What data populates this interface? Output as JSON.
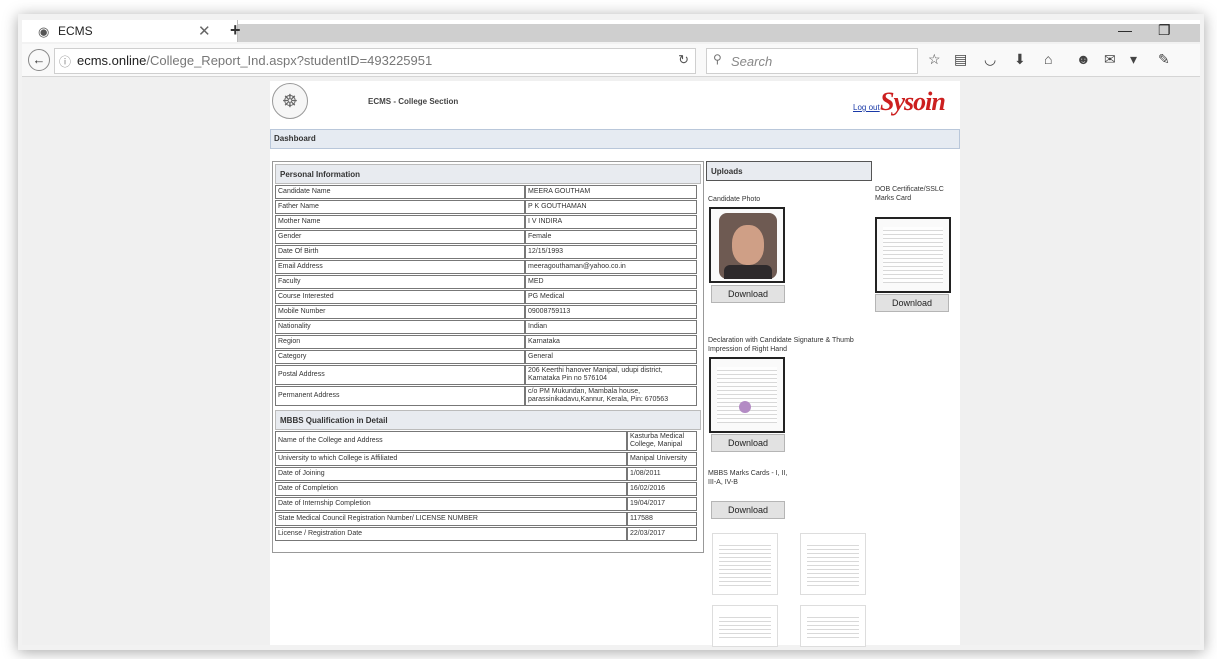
{
  "browser": {
    "tab_title": "ECMS",
    "url_domain": "ecms.online",
    "url_path": "/College_Report_Ind.aspx?studentID=493225951",
    "search_placeholder": "Search"
  },
  "header": {
    "section_title": "ECMS - College Section",
    "logout_label": "Log out",
    "brand_name": "Sysoin"
  },
  "dashboard_label": "Dashboard",
  "personal": {
    "heading": "Personal Information",
    "rows": [
      {
        "label": "Candidate Name",
        "value": "MEERA GOUTHAM"
      },
      {
        "label": "Father Name",
        "value": "P K GOUTHAMAN"
      },
      {
        "label": "Mother Name",
        "value": "I V INDIRA"
      },
      {
        "label": "Gender",
        "value": "Female"
      },
      {
        "label": "Date Of Birth",
        "value": "12/15/1993"
      },
      {
        "label": "Email Address",
        "value": "meeragouthaman@yahoo.co.in"
      },
      {
        "label": "Faculty",
        "value": "MED"
      },
      {
        "label": "Course Interested",
        "value": "PG Medical"
      },
      {
        "label": "Mobile Number",
        "value": "09008759113"
      },
      {
        "label": "Nationality",
        "value": "Indian"
      },
      {
        "label": "Region",
        "value": "Karnataka"
      },
      {
        "label": "Category",
        "value": "General"
      },
      {
        "label": "Postal Address",
        "value": "206 Keerthi hanover Manipal, udupi district, Karnataka Pin no 576104"
      },
      {
        "label": "Permanent Address",
        "value": "c/o PM Mukundan, Mambala house, parassinikadavu,Kannur, Kerala, Pin: 670563"
      }
    ]
  },
  "mbbs": {
    "heading": "MBBS Qualification in Detail",
    "rows": [
      {
        "label": "Name of the College and Address",
        "value": "Kasturba Medical College, Manipal"
      },
      {
        "label": "University to which College is Affiliated",
        "value": "Manipal University"
      },
      {
        "label": "Date of Joining",
        "value": "1/08/2011"
      },
      {
        "label": "Date of Completion",
        "value": "16/02/2016"
      },
      {
        "label": "Date of Internship Completion",
        "value": "19/04/2017"
      },
      {
        "label": "State Medical Council Registration Number/ LICENSE NUMBER",
        "value": "117588"
      },
      {
        "label": "License / Registration Date",
        "value": "22/03/2017"
      }
    ]
  },
  "uploads": {
    "heading": "Uploads",
    "candidate_photo_label": "Candidate Photo",
    "dob_label": "DOB Certificate/SSLC Marks Card",
    "declaration_label": "Declaration with Candidate Signature & Thumb Impression of Right Hand",
    "mbbs_marks_label": "MBBS Marks Cards - I, II, III-A, IV-B",
    "download_label": "Download"
  }
}
